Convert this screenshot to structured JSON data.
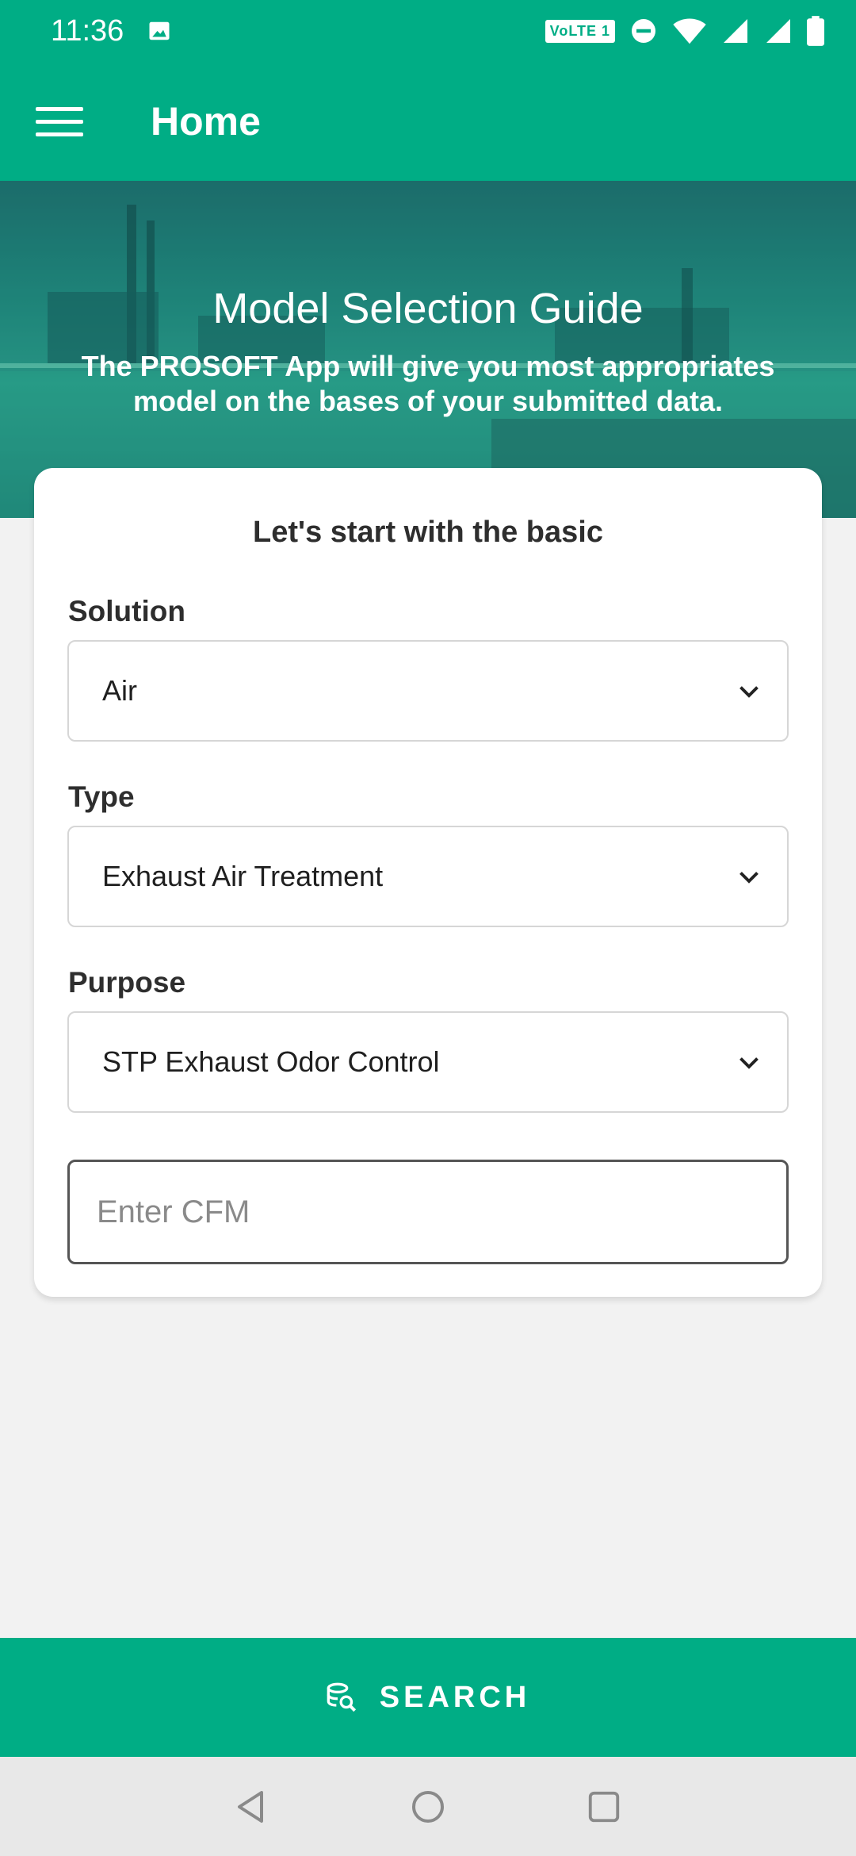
{
  "status_bar": {
    "time": "11:36",
    "left_icons": [
      "image-icon"
    ],
    "network_badge": "VoLTE 1",
    "right_icons": [
      "dnd-icon",
      "wifi-icon",
      "signal-icon",
      "signal-icon-2",
      "battery-icon"
    ]
  },
  "app_bar": {
    "title": "Home",
    "menu_icon": "hamburger-menu-icon"
  },
  "hero": {
    "title": "Model Selection Guide",
    "subtitle": "The PROSOFT App will give you most appropriates model on the bases of your submitted data."
  },
  "form": {
    "heading": "Let's start with the basic",
    "solution": {
      "label": "Solution",
      "value": "Air"
    },
    "type": {
      "label": "Type",
      "value": "Exhaust Air Treatment"
    },
    "purpose": {
      "label": "Purpose",
      "value": "STP Exhaust Odor Control"
    },
    "cfm": {
      "placeholder": "Enter CFM",
      "value": ""
    }
  },
  "search_button": {
    "label": "SEARCH",
    "icon": "search-database-icon"
  },
  "nav_bar": {
    "icons": [
      "back-icon",
      "home-icon",
      "recents-icon"
    ]
  },
  "colors": {
    "primary": "#00ad85",
    "background": "#f2f2f2",
    "card": "#ffffff",
    "nav_bar": "#e8e8e8"
  }
}
